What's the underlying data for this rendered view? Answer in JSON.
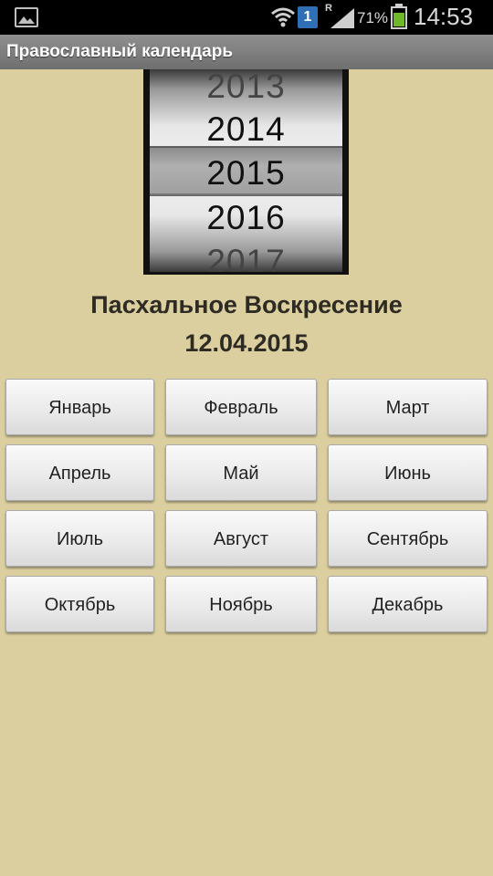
{
  "status_bar": {
    "icons": [
      "gallery-icon",
      "wifi-icon",
      "notification-1-icon",
      "roaming-icon",
      "signal-icon",
      "battery-icon"
    ],
    "notification_count": "1",
    "roaming": "R",
    "battery_percent": "71%",
    "battery_level": 0.71,
    "time": "14:53"
  },
  "app": {
    "title": "Православный календарь"
  },
  "year_picker": {
    "years": [
      "2013",
      "2014",
      "2015",
      "2016",
      "2017"
    ],
    "selected": "2015"
  },
  "easter": {
    "label": "Пасхальное Воскресение",
    "date": "12.04.2015"
  },
  "months": [
    "Январь",
    "Февраль",
    "Март",
    "Апрель",
    "Май",
    "Июнь",
    "Июль",
    "Август",
    "Сентябрь",
    "Октябрь",
    "Ноябрь",
    "Декабрь"
  ],
  "colors": {
    "background": "#dccf9f",
    "titlebar": "#7f7f7f",
    "text": "#2e2b24",
    "notification_badge": "#2f6fb6",
    "battery_fill": "#6fb82a"
  }
}
